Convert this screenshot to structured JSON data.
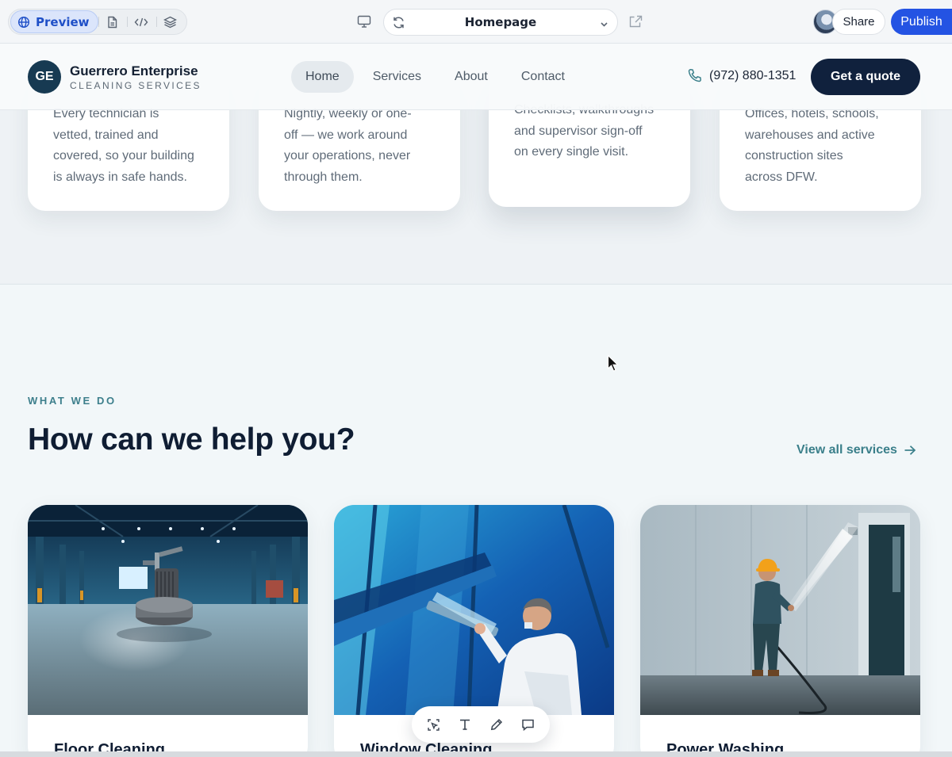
{
  "editor": {
    "preview_label": "Preview",
    "page_selector": "Homepage",
    "share_label": "Share",
    "publish_label": "Publish",
    "icons": [
      "globe-icon",
      "file-icon",
      "code-icon",
      "layers-icon",
      "desktop-icon",
      "refresh-icon",
      "chevron-down-icon",
      "external-link-icon"
    ]
  },
  "site": {
    "logo_initials": "GE",
    "brand_name": "Guerrero Enterprise",
    "brand_tagline": "CLEANING SERVICES",
    "nav": [
      {
        "label": "Home",
        "active": true
      },
      {
        "label": "Services",
        "active": false
      },
      {
        "label": "About",
        "active": false
      },
      {
        "label": "Contact",
        "active": false
      }
    ],
    "phone": "(972) 880-1351",
    "cta_label": "Get a quote"
  },
  "features": [
    {
      "lines": [
        "Every technician is",
        "vetted, trained and",
        "covered, so your building",
        "is always in safe hands."
      ]
    },
    {
      "lines": [
        "Nightly, weekly or one-",
        "off — we work around",
        "your operations, never",
        "through them."
      ]
    },
    {
      "lines": [
        "Checklists, walkthroughs",
        "and supervisor sign-off",
        "on every single visit."
      ]
    },
    {
      "lines": [
        "Offices, hotels, schools,",
        "warehouses and active",
        "construction sites",
        "across DFW."
      ]
    }
  ],
  "services_section": {
    "eyebrow": "WHAT WE DO",
    "heading": "How can we help you?",
    "view_all_label": "View all services",
    "cards": [
      {
        "title": "Floor Cleaning",
        "image": "warehouse-floor-scrubber"
      },
      {
        "title": "Window Cleaning",
        "image": "window-squeegee-worker"
      },
      {
        "title": "Power Washing",
        "image": "power-washing-worker"
      }
    ]
  },
  "edit_toolbar": [
    "select-icon",
    "text-icon",
    "pencil-icon",
    "comment-icon"
  ],
  "colors": {
    "publish": "#2453e3",
    "cta": "#10213d",
    "accent_teal": "#3a7f8a",
    "logo": "#173a52"
  }
}
